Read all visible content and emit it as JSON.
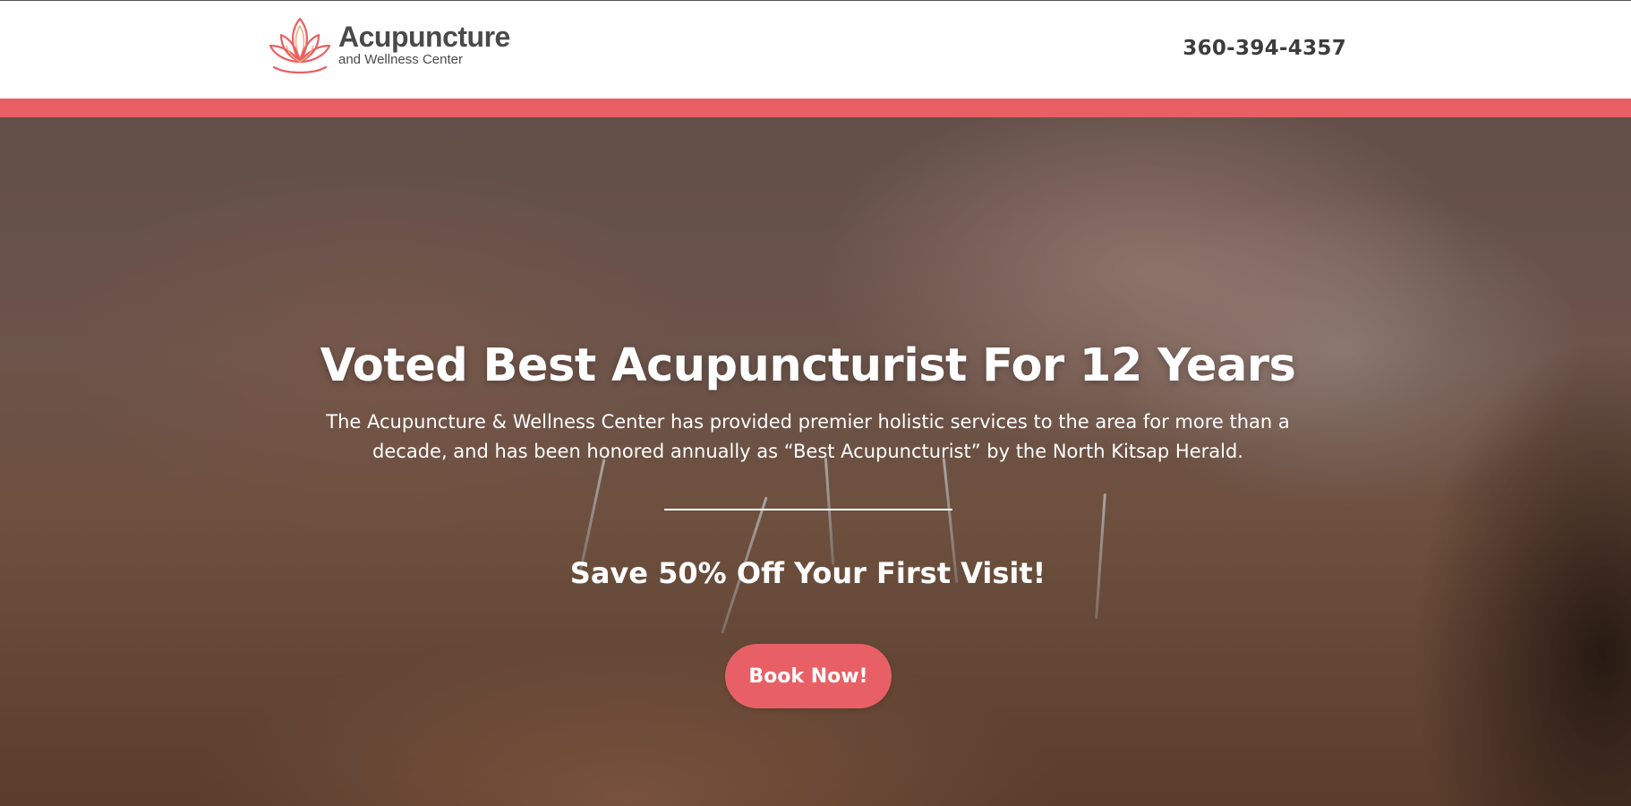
{
  "header": {
    "logo_title": "Acupuncture",
    "logo_subtitle": "and Wellness Center",
    "phone": "360-394-4357"
  },
  "hero": {
    "title": "Voted Best Acupuncturist For 12 Years",
    "description": "The Acupuncture & Wellness Center has provided premier holistic services to the area for more than a decade, and has been honored annually as “Best Acupuncturist” by the North Kitsap Herald.",
    "offer": "Save 50% Off Your First Visit!",
    "cta_label": "Book Now!"
  },
  "colors": {
    "accent": "#e86066",
    "logo_text": "#4a4a4a",
    "hero_text": "#ffffff"
  },
  "icons": {
    "logo_mark": "lotus-icon"
  }
}
